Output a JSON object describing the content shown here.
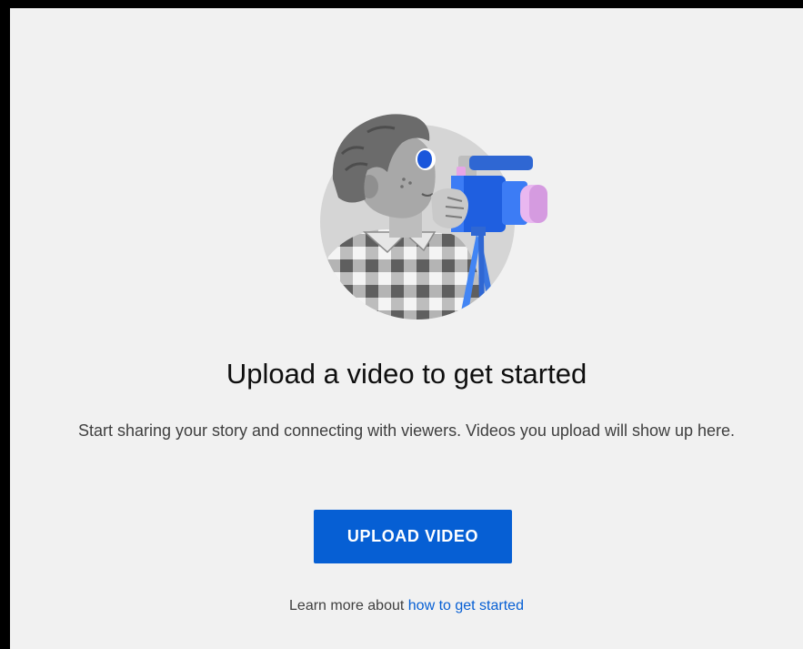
{
  "empty_state": {
    "illustration_icon": "person-filming-with-camera-illustration",
    "title": "Upload a video to get started",
    "description": "Start sharing your story and connecting with viewers. Videos you upload will show up here.",
    "upload_button_label": "UPLOAD VIDEO",
    "learn_more_prefix": "Learn more about",
    "learn_more_link_text": "how to get started"
  },
  "colors": {
    "background": "#f1f1f1",
    "accent": "#065fd4",
    "frame": "#000000"
  }
}
